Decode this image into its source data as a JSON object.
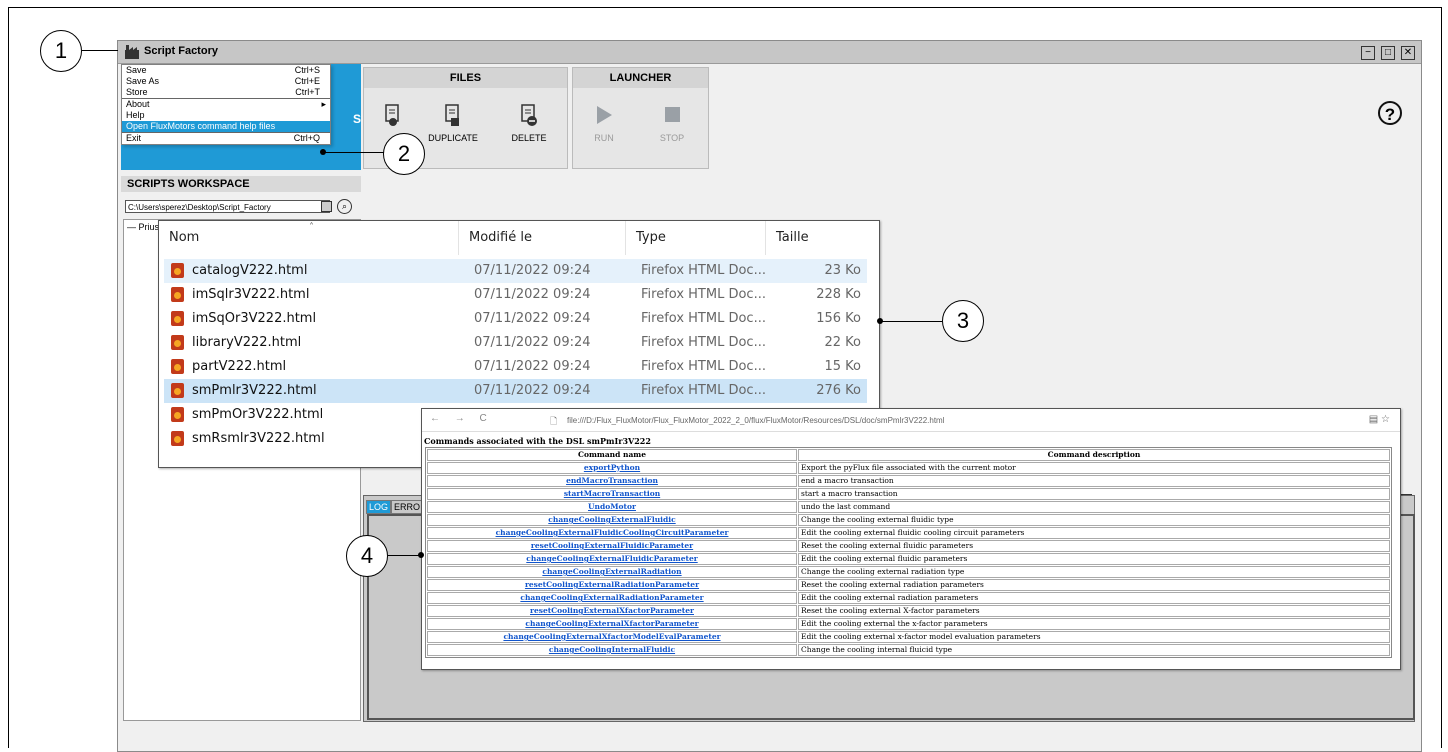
{
  "app": {
    "title": "Script Factory",
    "window_controls": [
      "−",
      "□",
      "✕"
    ]
  },
  "menu": {
    "items": [
      {
        "label": "Save",
        "shortcut": "Ctrl+S"
      },
      {
        "label": "Save As",
        "shortcut": "Ctrl+E"
      },
      {
        "label": "Store",
        "shortcut": "Ctrl+T"
      },
      {
        "label": "About",
        "shortcut": "▸"
      },
      {
        "label": "Help",
        "shortcut": ""
      },
      {
        "label": "Open FluxMotors command help files",
        "shortcut": ""
      },
      {
        "label": "Exit",
        "shortcut": "Ctrl+Q"
      }
    ]
  },
  "workspace": {
    "header": "SCRIPTS WORKSPACE",
    "path": "C:\\Users\\sperez\\Desktop\\Script_Factory",
    "tree_item": "— Prius",
    "blue_letter": "S"
  },
  "files_panel": {
    "title": "FILES",
    "buttons": [
      {
        "label": "DUPLICATE"
      },
      {
        "label": "DELETE"
      }
    ]
  },
  "launcher_panel": {
    "title": "LAUNCHER",
    "buttons": [
      {
        "label": "RUN"
      },
      {
        "label": "STOP"
      }
    ]
  },
  "help": {
    "symbol": "?"
  },
  "log": {
    "tabs": [
      "LOG",
      "ERRO"
    ]
  },
  "explorer": {
    "headers": {
      "name": "Nom",
      "modified": "Modifié le",
      "type": "Type",
      "size": "Taille"
    },
    "rows": [
      {
        "name": "catalogV222.html",
        "modified": "07/11/2022 09:24",
        "type": "Firefox HTML Doc...",
        "size": "23 Ko"
      },
      {
        "name": "imSqlr3V222.html",
        "modified": "07/11/2022 09:24",
        "type": "Firefox HTML Doc...",
        "size": "228 Ko"
      },
      {
        "name": "imSqOr3V222.html",
        "modified": "07/11/2022 09:24",
        "type": "Firefox HTML Doc...",
        "size": "156 Ko"
      },
      {
        "name": "libraryV222.html",
        "modified": "07/11/2022 09:24",
        "type": "Firefox HTML Doc...",
        "size": "22 Ko"
      },
      {
        "name": "partV222.html",
        "modified": "07/11/2022 09:24",
        "type": "Firefox HTML Doc...",
        "size": "15 Ko"
      },
      {
        "name": "smPmlr3V222.html",
        "modified": "07/11/2022 09:24",
        "type": "Firefox HTML Doc...",
        "size": "276 Ko"
      },
      {
        "name": "smPmOr3V222.html",
        "modified": "",
        "type": "",
        "size": ""
      },
      {
        "name": "smRsmlr3V222.html",
        "modified": "",
        "type": "",
        "size": ""
      }
    ]
  },
  "browser": {
    "nav": "← → C",
    "url": "file:///D:/Flux_FluxMotor/Flux_FluxMotor_2022_2_0/flux/FluxMotor/Resources/DSL/doc/smPmlr3V222.html",
    "right_icons": "▤ ☆",
    "page_title": "Commands associated with the DSL smPmIr3V222",
    "col_name": "Command name",
    "col_desc": "Command description",
    "commands": [
      {
        "name": "exportPython",
        "desc": "Export the pyFlux file associated with the current motor"
      },
      {
        "name": "endMacroTransaction",
        "desc": "end a macro transaction"
      },
      {
        "name": "startMacroTransaction",
        "desc": "start a macro transaction"
      },
      {
        "name": "UndoMotor",
        "desc": "undo the last command"
      },
      {
        "name": "changeCoolingExternalFluidic",
        "desc": "Change the cooling external fluidic type"
      },
      {
        "name": "changeCoolingExternalFluidicCoolingCircuitParameter",
        "desc": "Edit the cooling external fluidic cooling circuit parameters"
      },
      {
        "name": "resetCoolingExternalFluidicParameter",
        "desc": "Reset the cooling external fluidic parameters"
      },
      {
        "name": "changeCoolingExternalFluidicParameter",
        "desc": "Edit the cooling external fluidic parameters"
      },
      {
        "name": "changeCoolingExternalRadiation",
        "desc": "Change the cooling external radiation type"
      },
      {
        "name": "resetCoolingExternalRadiationParameter",
        "desc": "Reset the cooling external radiation parameters"
      },
      {
        "name": "changeCoolingExternalRadiationParameter",
        "desc": "Edit the cooling external radiation parameters"
      },
      {
        "name": "resetCoolingExternalXfactorParameter",
        "desc": "Reset the cooling external X-factor parameters"
      },
      {
        "name": "changeCoolingExternalXfactorParameter",
        "desc": "Edit the cooling external the x-factor parameters"
      },
      {
        "name": "changeCoolingExternalXfactorModelEvalParameter",
        "desc": "Edit the cooling external x-factor model evaluation parameters"
      },
      {
        "name": "changeCoolingInternalFluidic",
        "desc": "Change the cooling internal fluicid type"
      }
    ]
  },
  "callouts": [
    "1",
    "2",
    "3",
    "4"
  ]
}
